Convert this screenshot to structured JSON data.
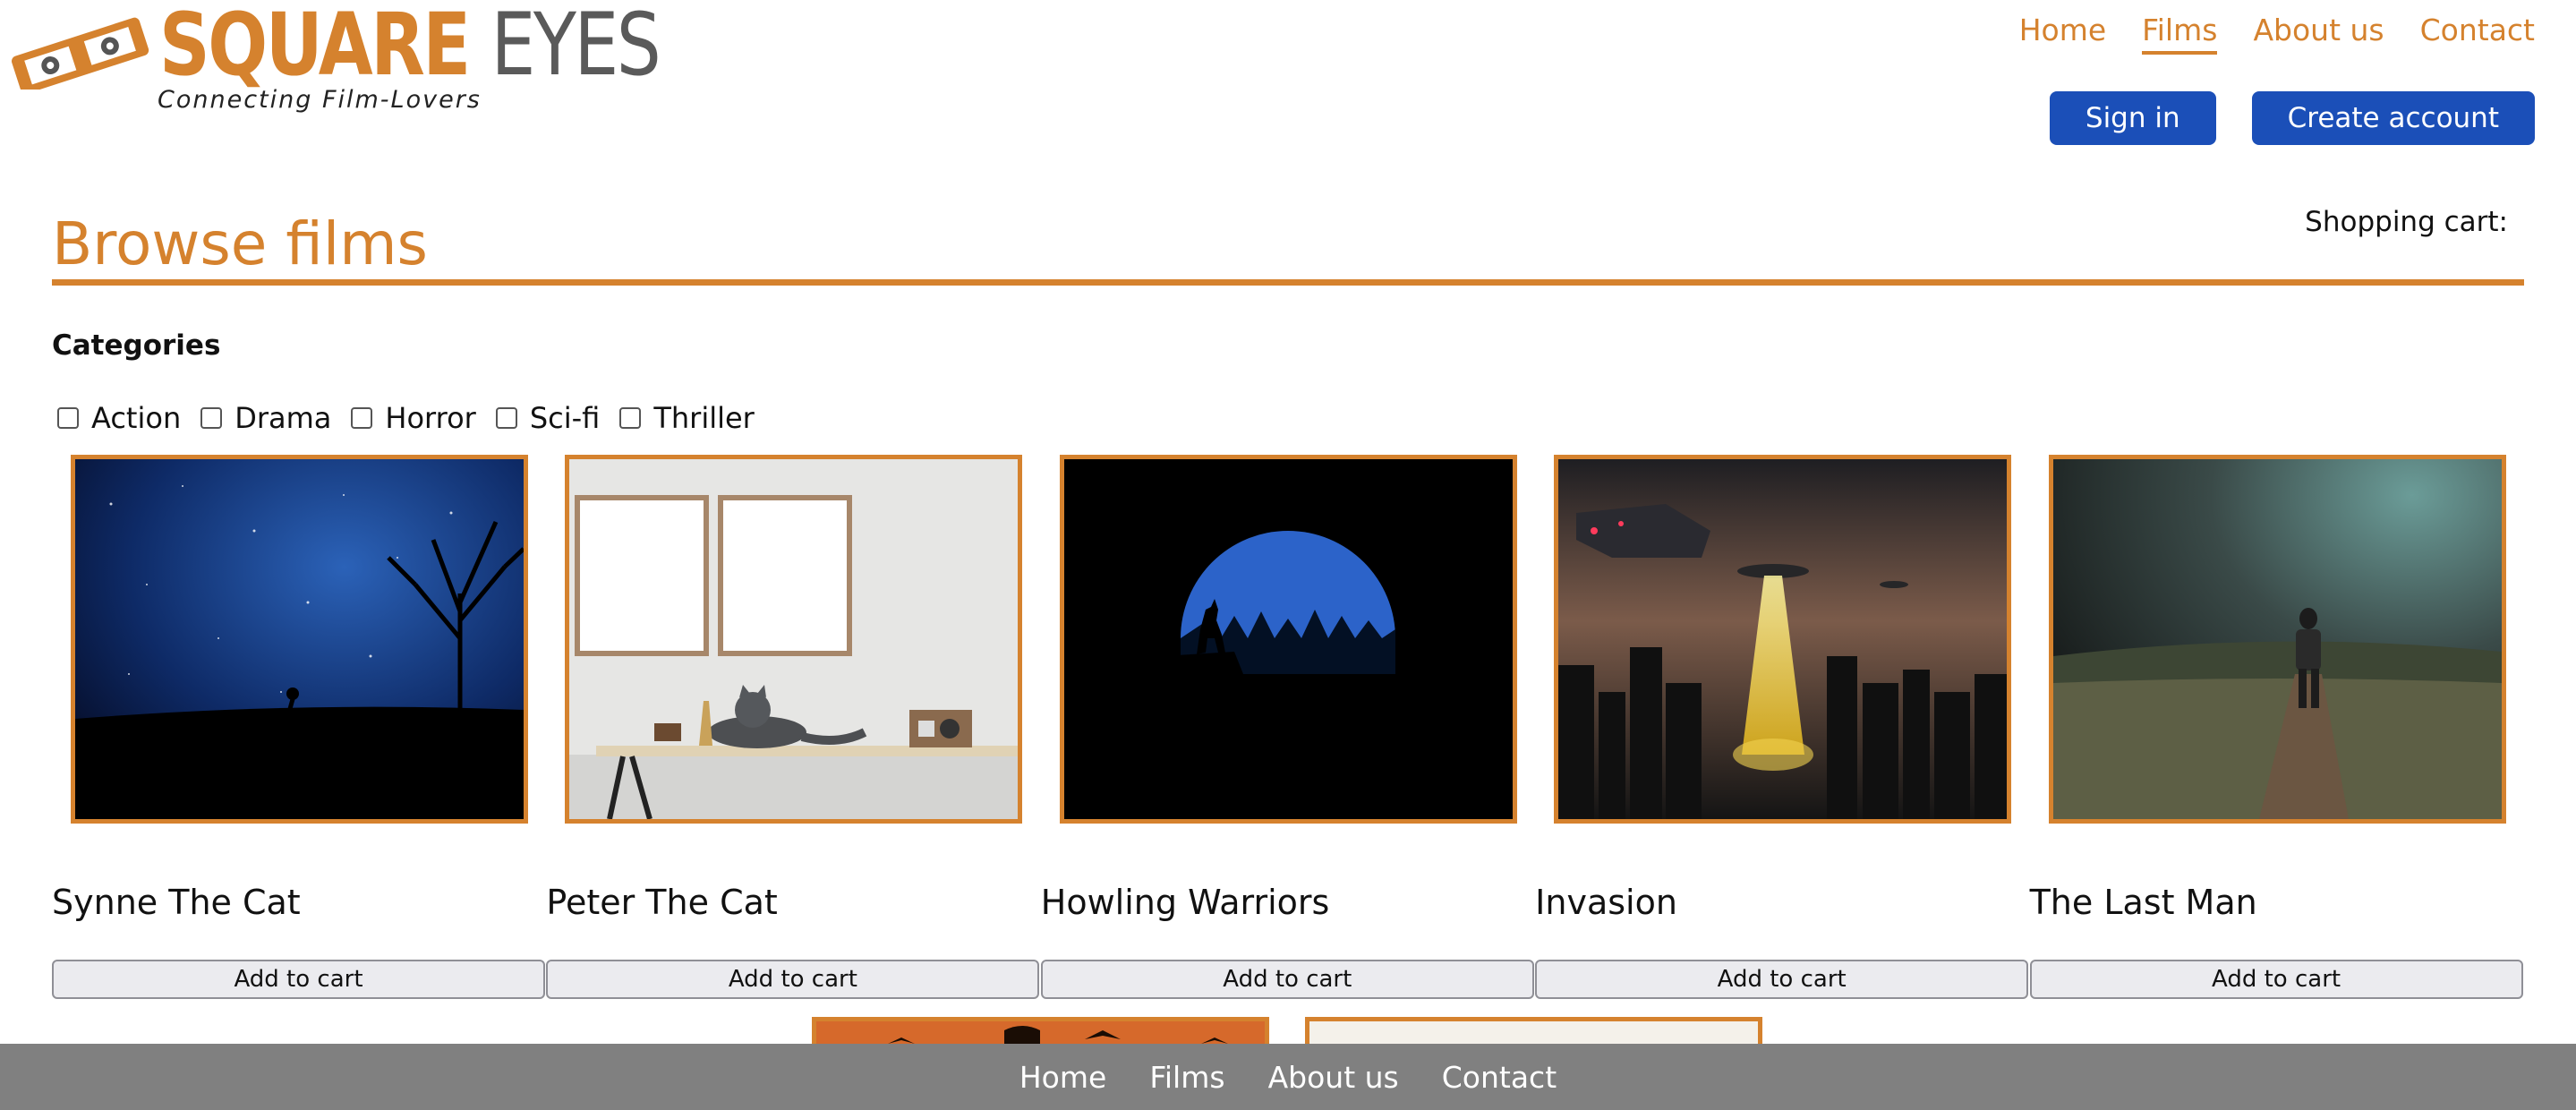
{
  "brand": {
    "name_part1": "SQUARE",
    "name_part2": "EYES",
    "tagline": "Connecting Film-Lovers",
    "color_primary": "#D5822E",
    "color_secondary": "#5a5a5a"
  },
  "top_nav": {
    "items": [
      {
        "label": "Home"
      },
      {
        "label": "Films"
      },
      {
        "label": "About us"
      },
      {
        "label": "Contact"
      }
    ],
    "active": "Films"
  },
  "auth": {
    "sign_in_label": "Sign in",
    "create_account_label": "Create account",
    "button_color": "#1B4FB8"
  },
  "page": {
    "title": "Browse films",
    "cart_label": "Shopping cart:"
  },
  "categories": {
    "title": "Categories",
    "options": [
      {
        "label": "Action",
        "checked": false
      },
      {
        "label": "Drama",
        "checked": false
      },
      {
        "label": "Horror",
        "checked": false
      },
      {
        "label": "Sci-fi",
        "checked": false
      },
      {
        "label": "Thriller",
        "checked": false
      }
    ]
  },
  "films": [
    {
      "title": "Synne The Cat",
      "button_label": "Add to cart",
      "poster_icon": "night-sky-cyclist-image"
    },
    {
      "title": "Peter The Cat",
      "button_label": "Add to cart",
      "poster_icon": "grey-cat-on-shelf-image"
    },
    {
      "title": "Howling Warriors",
      "button_label": "Add to cart",
      "poster_icon": "wolf-moon-image"
    },
    {
      "title": "Invasion",
      "button_label": "Add to cart",
      "poster_icon": "alien-invasion-city-image"
    },
    {
      "title": "The Last Man",
      "button_label": "Add to cart",
      "poster_icon": "man-walking-field-image"
    }
  ],
  "footer_nav": {
    "items": [
      {
        "label": "Home"
      },
      {
        "label": "Films"
      },
      {
        "label": "About us"
      },
      {
        "label": "Contact"
      }
    ],
    "background": "#808080"
  }
}
